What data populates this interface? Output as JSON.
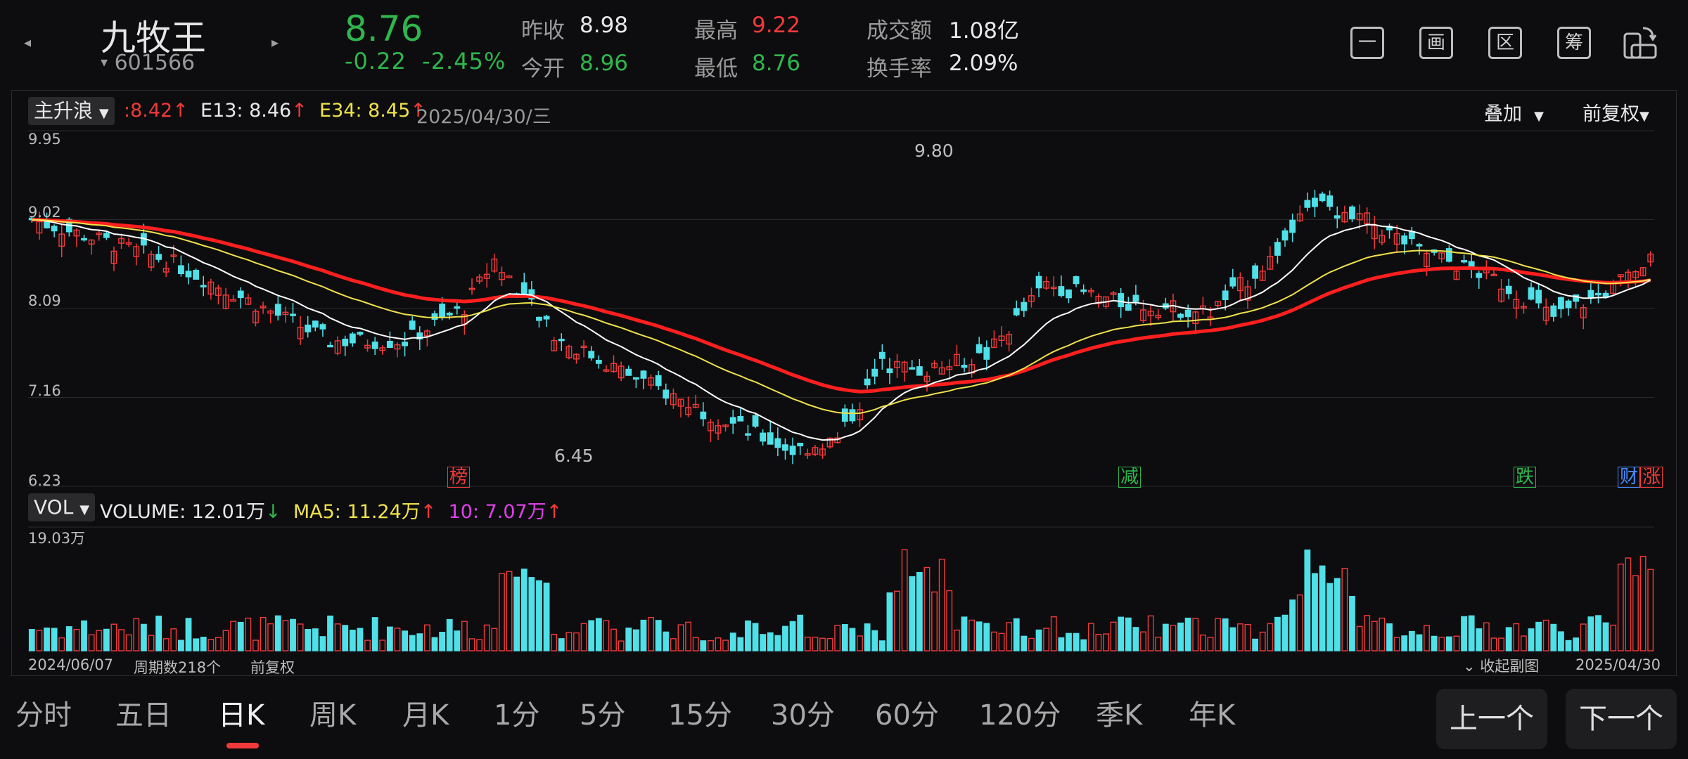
{
  "header": {
    "stock_name": "九牧王",
    "stock_code": "601566",
    "price": "8.76",
    "change": "-0.22",
    "change_pct": "-2.45%",
    "stats": {
      "prev_close_label": "昨收",
      "prev_close": "8.98",
      "open_label": "今开",
      "open": "8.96",
      "high_label": "最高",
      "high": "9.22",
      "low_label": "最低",
      "low": "8.76",
      "turnover_label": "成交额",
      "turnover": "1.08亿",
      "turnover_rate_label": "换手率",
      "turnover_rate": "2.09%"
    },
    "icons": [
      "一",
      "画",
      "区",
      "筹"
    ]
  },
  "main_chart": {
    "indicator": "主升浪",
    "legend": [
      {
        "text": ":8.42",
        "arrow": "↑",
        "color": "#f23a3a"
      },
      {
        "text": "E13: 8.46",
        "arrow": "↑",
        "color": "#e8e8e8"
      },
      {
        "text": "E34: 8.45",
        "arrow": "↑",
        "color": "#f0e24a"
      }
    ],
    "date": "2025/04/30/三",
    "overlay_label": "叠加",
    "adjust_label": "前复权",
    "y_labels": [
      "9.95",
      "9.02",
      "8.09",
      "7.16",
      "6.23"
    ],
    "high_label": "9.80",
    "low_label": "6.45",
    "markers": [
      {
        "text": "榜",
        "color": "#f23a3a"
      },
      {
        "text": "减",
        "color": "#2fb64c"
      },
      {
        "text": "跌",
        "color": "#2fb64c"
      },
      {
        "text": "财",
        "color": "#4a8cff"
      },
      {
        "text": "涨",
        "color": "#f23a3a"
      }
    ]
  },
  "volume_chart": {
    "indicator": "VOL",
    "legend": [
      {
        "text": "VOLUME: 12.01万",
        "arrow": "↓",
        "color": "#e8e8e8",
        "arrow_color": "#2fb64c"
      },
      {
        "text": "MA5: 11.24万",
        "arrow": "↑",
        "color": "#f0e24a",
        "arrow_color": "#f23a3a"
      },
      {
        "text": "10: 7.07万",
        "arrow": "↑",
        "color": "#e040e8",
        "arrow_color": "#f23a3a"
      }
    ],
    "y_max_label": "19.03万"
  },
  "footer": {
    "start_date": "2024/06/07",
    "period_count": "周期数218个",
    "adjust": "前复权",
    "collapse": "收起副图",
    "end_date": "2025/04/30"
  },
  "tabs": [
    "分时",
    "五日",
    "日K",
    "周K",
    "月K",
    "1分",
    "5分",
    "15分",
    "30分",
    "60分",
    "120分",
    "季K",
    "年K"
  ],
  "active_tab": "日K",
  "buttons": {
    "prev": "上一个",
    "next": "下一个"
  },
  "chart_data": {
    "type": "candlestick",
    "x": [
      "2024/06/07",
      "2025/04/30"
    ],
    "period_count": 218,
    "ylim": [
      6.23,
      9.95
    ],
    "high": 9.8,
    "low": 6.45,
    "series": [
      {
        "name": "",
        "color": "#f23a3a"
      },
      {
        "name": "E13",
        "color": "#e8e8e8"
      },
      {
        "name": "E34",
        "color": "#f0e24a"
      }
    ],
    "volume_ylim": [
      0,
      19.03
    ],
    "volume_unit": "万",
    "colors": {
      "up": "#f23a3a",
      "down": "#4fe0e8",
      "ma": "#f0e24a",
      "ma10": "#e040e8"
    }
  }
}
